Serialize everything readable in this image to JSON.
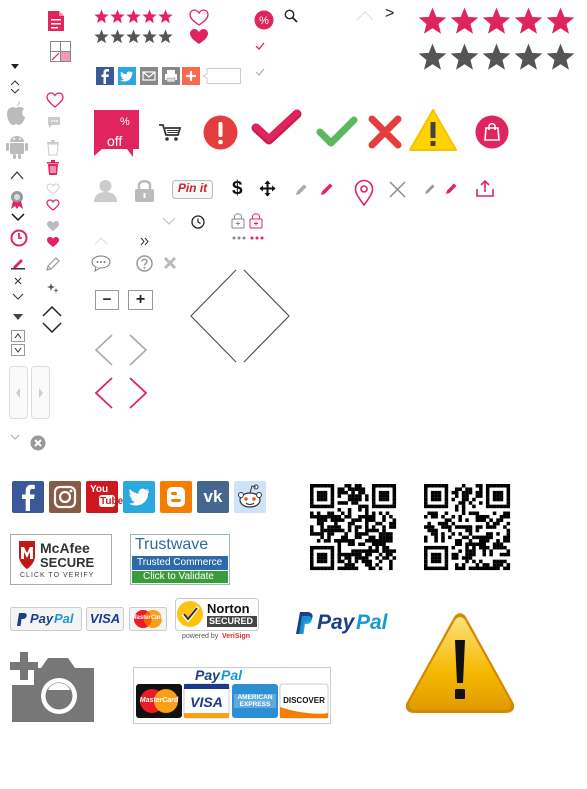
{
  "colors": {
    "accent": "#e0245e",
    "gray": "#777777",
    "light_gray": "#cccccc",
    "green": "#5cb85c",
    "red": "#e43d3d",
    "yellow": "#ffd200"
  },
  "badge": {
    "percent": "%",
    "off": "off"
  },
  "pinit": "Pin it",
  "dollar": "$",
  "zoom": {
    "minus": "−",
    "plus": "+"
  },
  "chevron_right": ">",
  "social_icons": [
    "facebook-icon",
    "instagram-icon",
    "youtube-icon",
    "twitter-icon",
    "blogger-icon",
    "vk-icon",
    "reddit-icon"
  ],
  "youtube": {
    "you": "You",
    "tube": "Tube"
  },
  "vk": "vk",
  "blogger": "B",
  "mcafee": {
    "name": "McAfee",
    "secure": "SECURE",
    "sub": "CLICK TO VERIFY"
  },
  "trustwave": {
    "name": "Trustwave",
    "sub": "Trusted Commerce",
    "cta": "Click to Validate"
  },
  "payments": {
    "paypal_pay": "Pay",
    "paypal_pal": "Pal",
    "visa": "VISA",
    "mastercard": "MasterCard",
    "amex": "AMERICAN EXPRESS",
    "discover": "DISCOVER"
  },
  "norton": {
    "name": "Norton",
    "secured": "SECURED",
    "powered": "powered by",
    "verisign": "VeriSign"
  }
}
